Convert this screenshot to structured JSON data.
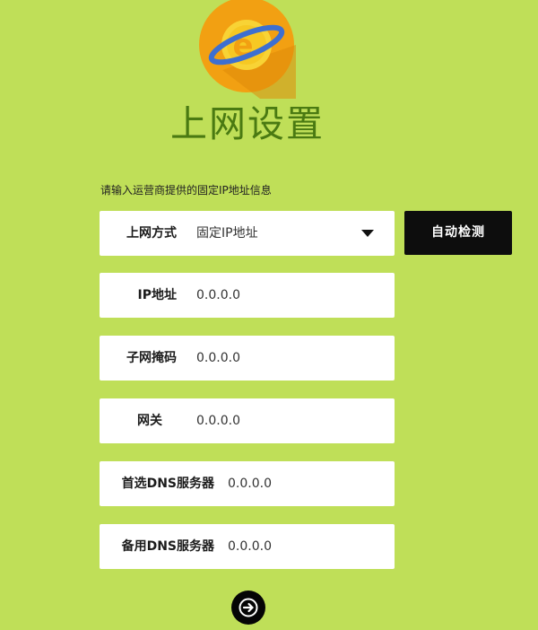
{
  "page": {
    "title": "上网设置",
    "instruction": "请输入运营商提供的固定IP地址信息"
  },
  "logo": {
    "icon": "ie-globe-icon",
    "letter": "e"
  },
  "connection_type": {
    "label": "上网方式",
    "value": "固定IP地址"
  },
  "auto_detect": {
    "label": "自动检测"
  },
  "fields": {
    "ip": {
      "label": "IP地址",
      "value": "0.0.0.0"
    },
    "subnet": {
      "label": "子网掩码",
      "value": "0.0.0.0"
    },
    "gateway": {
      "label": "网关",
      "value": "0.0.0.0"
    },
    "dns_primary": {
      "label": "首选DNS服务器",
      "value": "0.0.0.0"
    },
    "dns_secondary": {
      "label": "备用DNS服务器",
      "value": "0.0.0.0"
    }
  },
  "next_button": {
    "icon": "arrow-right-icon"
  },
  "colors": {
    "background": "#bfdf58",
    "title": "#4a7a12",
    "button": "#0d0d0d",
    "logo_orange": "#f2a012",
    "logo_blue": "#3d6fd0"
  }
}
